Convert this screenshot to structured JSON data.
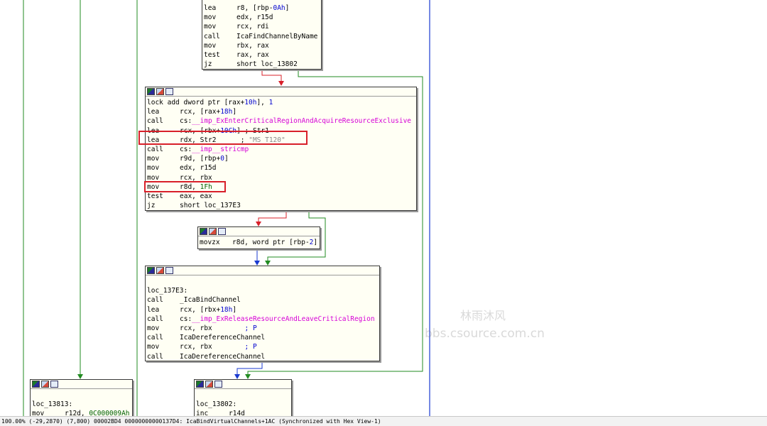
{
  "blocks": {
    "top": {
      "lines": [
        {
          "m": "lea",
          "o": [
            {
              "t": "r8, [rbp-"
            },
            {
              "t": "0Ah",
              "c": "cmt"
            },
            {
              "t": "]"
            }
          ]
        },
        {
          "m": "mov",
          "o": [
            {
              "t": "edx, r15d"
            }
          ]
        },
        {
          "m": "mov",
          "o": [
            {
              "t": "rcx, rdi"
            }
          ]
        },
        {
          "m": "call",
          "o": [
            {
              "t": "IcaFindChannelByName"
            }
          ]
        },
        {
          "m": "mov",
          "o": [
            {
              "t": "rbx, rax"
            }
          ]
        },
        {
          "m": "test",
          "o": [
            {
              "t": "rax, rax"
            }
          ]
        },
        {
          "m": "jz",
          "o": [
            {
              "t": "short loc_13802"
            }
          ]
        }
      ]
    },
    "main": {
      "lines": [
        {
          "m": "lock add",
          "o": [
            {
              "t": " dword ptr [rax+"
            },
            {
              "t": "10h",
              "c": "cmt"
            },
            {
              "t": "], "
            },
            {
              "t": "1",
              "c": "cmt"
            }
          ]
        },
        {
          "m": "lea",
          "o": [
            {
              "t": "rcx, [rax+"
            },
            {
              "t": "18h",
              "c": "cmt"
            },
            {
              "t": "]"
            }
          ]
        },
        {
          "m": "call",
          "o": [
            {
              "t": "cs:"
            },
            {
              "t": "__imp_ExEnterCriticalRegionAndAcquireResourceExclusive",
              "c": "imp"
            }
          ]
        },
        {
          "m": "lea",
          "o": [
            {
              "t": "rcx, [rbx+"
            },
            {
              "t": "10Ch",
              "c": "cmt"
            },
            {
              "t": "] ; Str1"
            }
          ]
        },
        {
          "m": "lea",
          "o": [
            {
              "t": "rdx, Str2      ; "
            },
            {
              "t": "\"MS_T120\"",
              "c": "str"
            }
          ]
        },
        {
          "m": "call",
          "o": [
            {
              "t": "cs:"
            },
            {
              "t": "__imp__stricmp",
              "c": "imp"
            }
          ]
        },
        {
          "m": "mov",
          "o": [
            {
              "t": "r9d, [rbp+"
            },
            {
              "t": "0",
              "c": "cmt"
            },
            {
              "t": "]"
            }
          ]
        },
        {
          "m": "mov",
          "o": [
            {
              "t": "edx, r15d"
            }
          ]
        },
        {
          "m": "mov",
          "o": [
            {
              "t": "rcx, rbx"
            }
          ]
        },
        {
          "m": "mov",
          "o": [
            {
              "t": "r8d, "
            },
            {
              "t": "1Fh",
              "c": "num"
            }
          ]
        },
        {
          "m": "test",
          "o": [
            {
              "t": "eax, eax"
            }
          ]
        },
        {
          "m": "jz",
          "o": [
            {
              "t": "short loc_137E3"
            }
          ]
        }
      ]
    },
    "small": {
      "lines": [
        {
          "m": "movzx",
          "o": [
            {
              "t": "r8d, word ptr [rbp-"
            },
            {
              "t": "2",
              "c": "cmt"
            },
            {
              "t": "]"
            }
          ]
        }
      ]
    },
    "loc137e3": {
      "lines": [
        {
          "empty": true
        },
        {
          "label": "loc_137E3:"
        },
        {
          "m": "call",
          "o": [
            {
              "t": "_IcaBindChannel"
            }
          ]
        },
        {
          "m": "lea",
          "o": [
            {
              "t": "rcx, [rbx+"
            },
            {
              "t": "18h",
              "c": "cmt"
            },
            {
              "t": "]"
            }
          ]
        },
        {
          "m": "call",
          "o": [
            {
              "t": "cs:"
            },
            {
              "t": "__imp_ExReleaseResourceAndLeaveCriticalRegion",
              "c": "imp"
            }
          ]
        },
        {
          "m": "mov",
          "o": [
            {
              "t": "rcx, rbx        ; P",
              "c": "cmtP"
            }
          ]
        },
        {
          "m": "call",
          "o": [
            {
              "t": "IcaDereferenceChannel"
            }
          ]
        },
        {
          "m": "mov",
          "o": [
            {
              "t": "rcx, rbx        ; P",
              "c": "cmtP"
            }
          ]
        },
        {
          "m": "call",
          "o": [
            {
              "t": "IcaDereferenceChannel"
            }
          ]
        }
      ]
    },
    "loc13813": {
      "lines": [
        {
          "empty": true
        },
        {
          "label": "loc_13813:"
        },
        {
          "m": "mov",
          "o": [
            {
              "t": "r12d, "
            },
            {
              "t": "0C000009Ah",
              "c": "num"
            }
          ]
        }
      ]
    },
    "loc13802": {
      "lines": [
        {
          "empty": true
        },
        {
          "label": "loc_13802:"
        },
        {
          "m": "inc",
          "o": [
            {
              "t": "r14d"
            }
          ]
        }
      ]
    }
  },
  "watermark": {
    "line1": "林雨沐风",
    "line2": "bbs.csource.com.cn"
  },
  "status_bar": "100.00% (-29,2870) (7,800) 00002BD4 00000000000137D4: IcaBindVirtualChannels+1AC (Synchronized with Hex View-1)",
  "colors": {
    "edge_true": "#228b22",
    "edge_false": "#d8202a",
    "edge_seq": "#1a3ad0",
    "highlight": "#d8202a"
  }
}
